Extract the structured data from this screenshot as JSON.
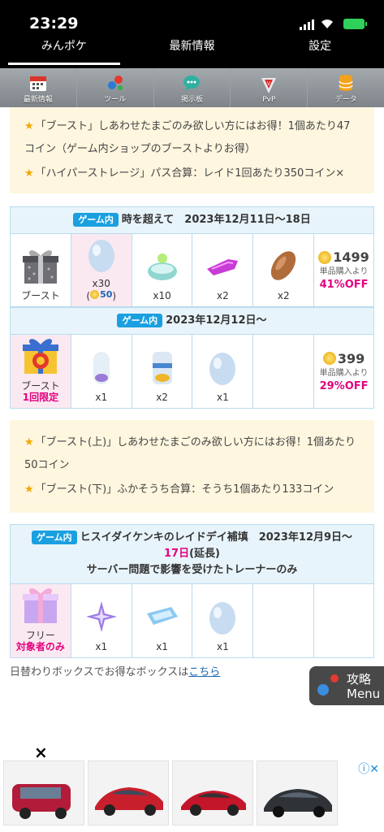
{
  "status": {
    "time": "23:29"
  },
  "topnav": {
    "tabs": [
      "みんポケ",
      "最新情報",
      "設定"
    ]
  },
  "iconbar": {
    "items": [
      "最新情報",
      "ツール",
      "掲示板",
      "PvP",
      "データ"
    ]
  },
  "note1": {
    "lines": [
      "「ブースト」しあわせたまごのみ欲しい方にはお得！1個あたり47コイン（ゲーム内ショップのブーストよりお得）",
      "「ハイパーストレージ」パス合算：レイド1回あたり350コイン×"
    ]
  },
  "box1": {
    "header1": {
      "badge": "ゲーム内",
      "title": "時を超えて　2023年12月11日〜18日"
    },
    "row1": {
      "box_label": "ブースト",
      "items": [
        {
          "icon": "lucky-egg-icon",
          "qty": "x30",
          "sub_open": "(",
          "sub_price": "50",
          "sub_close": ")"
        },
        {
          "icon": "incense-icon",
          "qty": "x10"
        },
        {
          "icon": "star-piece-icon",
          "qty": "x2"
        },
        {
          "icon": "poffin-icon",
          "qty": "x2"
        }
      ],
      "price": "1499",
      "price_note": "単品購入より",
      "discount": "41%OFF"
    },
    "header2": {
      "badge": "ゲーム内",
      "title": "2023年12月12日〜"
    },
    "row2": {
      "box_label": "ブースト",
      "box_limit": "1回限定",
      "items": [
        {
          "icon": "incubator-icon",
          "qty": "x1"
        },
        {
          "icon": "super-incubator-icon",
          "qty": "x2"
        },
        {
          "icon": "lucky-egg-icon",
          "qty": "x1"
        },
        {
          "icon": "empty",
          "qty": ""
        }
      ],
      "price": "399",
      "price_note": "単品購入より",
      "discount": "29%OFF"
    }
  },
  "note2": {
    "lines": [
      "「ブースト(上)」しあわせたまごのみ欲しい方にはお得！1個あたり50コイン",
      "「ブースト(下)」ふかそうち合算：そうち1個あたり133コイン"
    ]
  },
  "box2": {
    "header": {
      "badge": "ゲーム内",
      "title": "ヒスイダイケンキのレイドデイ補填　2023年12月9日〜",
      "date_red": "17日",
      "date_suffix": "(延長)",
      "subtitle": "サーバー問題で影響を受けたトレーナーのみ"
    },
    "row": {
      "box_label": "フリー",
      "box_limit": "対象者のみ",
      "items": [
        {
          "icon": "star-piece-icon",
          "qty": "x1"
        },
        {
          "icon": "remote-raid-pass-icon",
          "qty": "x1"
        },
        {
          "icon": "lucky-egg-icon",
          "qty": "x1"
        },
        {
          "icon": "empty",
          "qty": ""
        }
      ]
    }
  },
  "footer": {
    "text": "日替わりボックスでお得なボックスは",
    "link": "こちら"
  },
  "float_menu": {
    "line1": "攻略",
    "line2": "Menu"
  },
  "ad": {
    "close": "×",
    "info": "ⓘ✕"
  }
}
